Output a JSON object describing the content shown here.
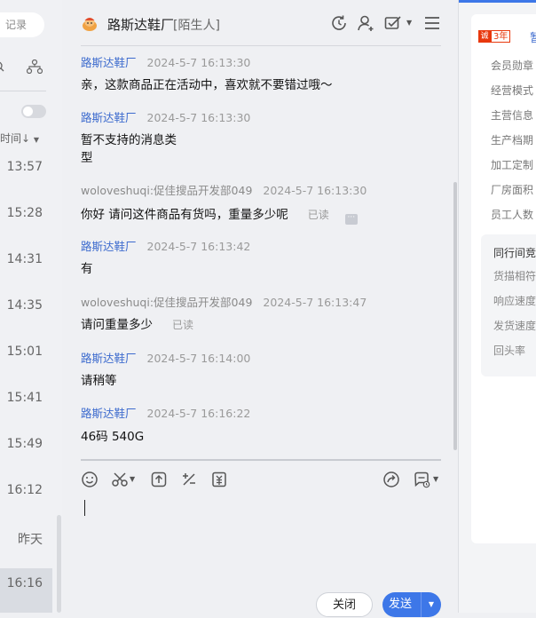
{
  "left": {
    "search_placeholder": "记录",
    "sort_label": "时间↓",
    "times": [
      "13:57",
      "15:28",
      "14:31",
      "14:35",
      "15:01",
      "15:41",
      "15:49",
      "16:12",
      "昨天",
      "16:16"
    ]
  },
  "chat": {
    "contact_name": "路斯达鞋厂",
    "contact_tag": "[陌生人]",
    "messages": [
      {
        "who": "路斯达鞋厂",
        "time": "2024-5-7 16:13:30",
        "lines": [
          "亲，这款商品正在活动中，喜欢就不要错过哦～"
        ]
      },
      {
        "who": "路斯达鞋厂",
        "time": "2024-5-7 16:13:30",
        "lines": [
          "暂不支持的消息类",
          "型"
        ]
      },
      {
        "who": "woloveshuqi:促佳搜品开发部049",
        "time": "2024-5-7 16:13:30",
        "lines": [
          "你好 请问这件商品有货吗，重量多少呢"
        ],
        "status": "已读"
      },
      {
        "who": "路斯达鞋厂",
        "time": "2024-5-7 16:13:42",
        "lines": [
          "有"
        ]
      },
      {
        "who": "woloveshuqi:促佳搜品开发部049",
        "time": "2024-5-7 16:13:47",
        "lines": [
          "请问重量多少"
        ],
        "status": "已读"
      },
      {
        "who": "路斯达鞋厂",
        "time": "2024-5-7 16:14:00",
        "lines": [
          "请稍等"
        ]
      },
      {
        "who": "路斯达鞋厂",
        "time": "2024-5-7 16:16:22",
        "lines": [
          "46码 540G"
        ]
      }
    ],
    "close_label": "关闭",
    "send_label": "发送"
  },
  "right": {
    "badge_icon": "诚",
    "years": "3年",
    "store_short": "暂",
    "info_items": [
      "会员勋章",
      "经营模式",
      "主营信息",
      "生产档期",
      "加工定制",
      "厂房面积",
      "员工人数"
    ],
    "peer_title": "同行间竞",
    "peer_items": [
      "货描相符",
      "响应速度",
      "发货速度",
      "回头率"
    ]
  },
  "colors": {
    "accent": "#3d77e8",
    "link": "#3d6bce",
    "badge": "#e8380d"
  }
}
